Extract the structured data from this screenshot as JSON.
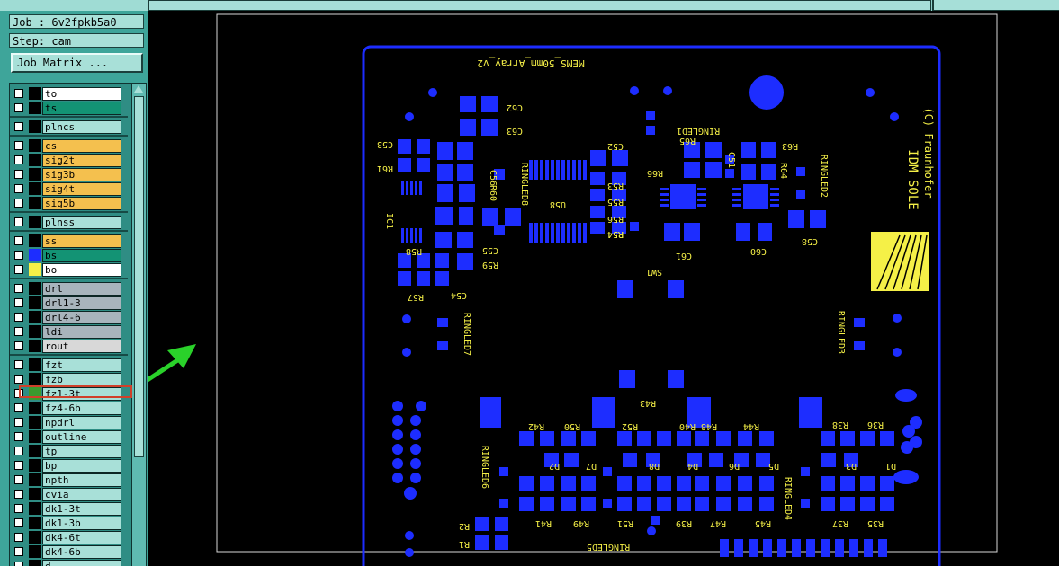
{
  "job": "Job : 6v2fpkb5a0",
  "step": "Step: cam",
  "job_matrix_label": "Job Matrix ...",
  "colors": {
    "board_copper": "#1d2dff",
    "silk": "#f5f047",
    "panel": "#3ea59a",
    "layer_yellow": "#f4c04e",
    "layer_green": "#139374",
    "layer_teal": "#a8e0d8",
    "layer_grey": "#a8b4bc",
    "annotation_arrow": "#2ad12a",
    "highlight_box": "#d0402a"
  },
  "layers": [
    {
      "group": 0,
      "name": "to",
      "swatch": "#000000",
      "bg": "#ffffff"
    },
    {
      "group": 0,
      "name": "ts",
      "swatch": "#000000",
      "bg": "#139374"
    },
    {
      "group": 1,
      "name": "plncs",
      "swatch": "#000000",
      "bg": "#a8e0d8"
    },
    {
      "group": 2,
      "name": "cs",
      "swatch": "#000000",
      "bg": "#f4c04e"
    },
    {
      "group": 2,
      "name": "sig2t",
      "swatch": "#000000",
      "bg": "#f4c04e"
    },
    {
      "group": 2,
      "name": "sig3b",
      "swatch": "#000000",
      "bg": "#f4c04e"
    },
    {
      "group": 2,
      "name": "sig4t",
      "swatch": "#000000",
      "bg": "#f4c04e"
    },
    {
      "group": 2,
      "name": "sig5b",
      "swatch": "#000000",
      "bg": "#f4c04e"
    },
    {
      "group": 3,
      "name": "plnss",
      "swatch": "#000000",
      "bg": "#a8e0d8"
    },
    {
      "group": 4,
      "name": "ss",
      "swatch": "#000000",
      "bg": "#f4c04e"
    },
    {
      "group": 4,
      "name": "bs",
      "swatch": "#1d2dff",
      "bg": "#139374"
    },
    {
      "group": 4,
      "name": "bo",
      "swatch": "#f5f047",
      "bg": "#ffffff"
    },
    {
      "group": 5,
      "name": "drl",
      "swatch": "#000000",
      "bg": "#a8b4bc"
    },
    {
      "group": 5,
      "name": "drl1-3",
      "swatch": "#000000",
      "bg": "#a8b4bc"
    },
    {
      "group": 5,
      "name": "drl4-6",
      "swatch": "#000000",
      "bg": "#a8b4bc"
    },
    {
      "group": 5,
      "name": "ldi",
      "swatch": "#000000",
      "bg": "#a8b4bc"
    },
    {
      "group": 5,
      "name": "rout",
      "swatch": "#000000",
      "bg": "#d8d8d8"
    },
    {
      "group": 6,
      "name": "fzt",
      "swatch": "#000000",
      "bg": "#a8e0d8"
    },
    {
      "group": 6,
      "name": "fzb",
      "swatch": "#000000",
      "bg": "#a8e0d8"
    },
    {
      "group": 6,
      "name": "fz1-3t",
      "swatch": "#3b9a2e",
      "bg": "#a8e0d8"
    },
    {
      "group": 6,
      "name": "fz4-6b",
      "swatch": "#000000",
      "bg": "#a8e0d8"
    },
    {
      "group": 6,
      "name": "npdrl",
      "swatch": "#000000",
      "bg": "#a8e0d8"
    },
    {
      "group": 6,
      "name": "outline",
      "swatch": "#000000",
      "bg": "#a8e0d8"
    },
    {
      "group": 6,
      "name": "tp",
      "swatch": "#000000",
      "bg": "#a8e0d8"
    },
    {
      "group": 6,
      "name": "bp",
      "swatch": "#000000",
      "bg": "#a8e0d8"
    },
    {
      "group": 6,
      "name": "npth",
      "swatch": "#000000",
      "bg": "#a8e0d8"
    },
    {
      "group": 6,
      "name": "cvia",
      "swatch": "#000000",
      "bg": "#a8e0d8"
    },
    {
      "group": 6,
      "name": "dk1-3t",
      "swatch": "#000000",
      "bg": "#a8e0d8"
    },
    {
      "group": 6,
      "name": "dk1-3b",
      "swatch": "#000000",
      "bg": "#a8e0d8"
    },
    {
      "group": 6,
      "name": "dk4-6t",
      "swatch": "#000000",
      "bg": "#a8e0d8"
    },
    {
      "group": 6,
      "name": "dk4-6b",
      "swatch": "#000000",
      "bg": "#a8e0d8"
    },
    {
      "group": 6,
      "name": "d",
      "swatch": "#000000",
      "bg": "#a8e0d8"
    }
  ],
  "selected_layer": "fz1-3t",
  "pcb": {
    "board_title": "MEMS_50mm_Array_v2",
    "logo_text_1": "IDM SOLE",
    "logo_text_2": "(C) Fraunhofer",
    "silk_labels": [
      "C62",
      "C63",
      "C56",
      "RINGLED8",
      "C52",
      "R66",
      "R53",
      "R55",
      "R56",
      "R54",
      "U58",
      "R54",
      "R65",
      "RINGLED1",
      "R63",
      "R64",
      "RINGLED2",
      "C53",
      "R61",
      "R60",
      "C51",
      "C55",
      "R59",
      "C54",
      "R57",
      "R58",
      "IC1",
      "C61",
      "C60",
      "C58",
      "SW1",
      "RINGLED3",
      "RINGLED7",
      "R42",
      "R50",
      "R52",
      "R40",
      "R48",
      "R44",
      "R38",
      "R36",
      "R43",
      "D2",
      "D7",
      "D8",
      "D4",
      "D6",
      "D5",
      "D3",
      "D1",
      "RINGLED6",
      "RINGLED4",
      "R2",
      "R1",
      "R41",
      "R49",
      "R51",
      "R39",
      "R47",
      "R45",
      "R37",
      "R35",
      "RINGLED5"
    ]
  }
}
